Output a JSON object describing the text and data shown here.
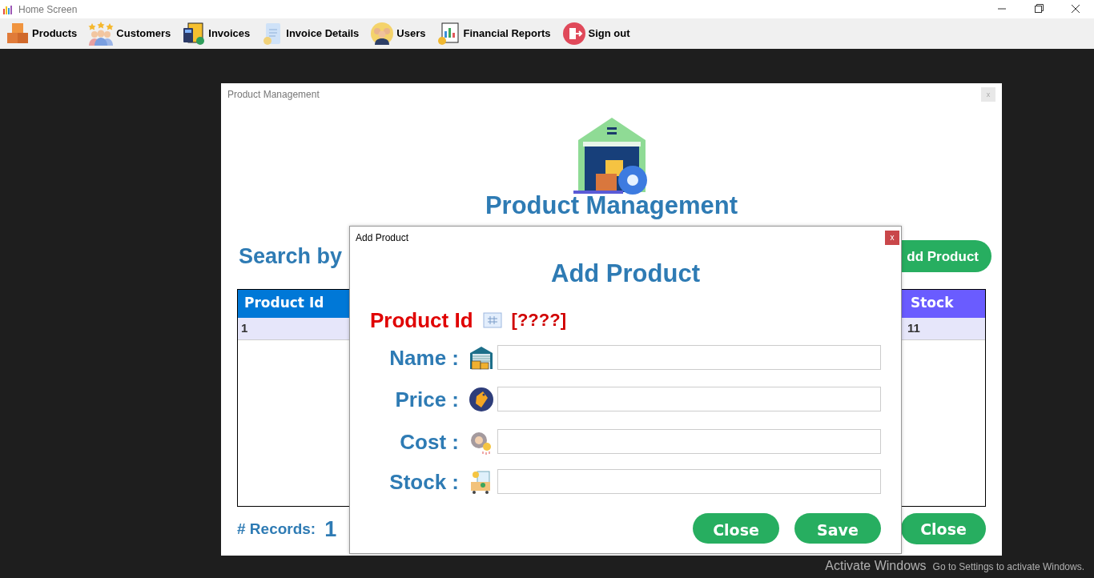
{
  "window": {
    "title": "Home Screen"
  },
  "menu": [
    {
      "label": "Products"
    },
    {
      "label": "Customers"
    },
    {
      "label": "Invoices"
    },
    {
      "label": "Invoice Details"
    },
    {
      "label": "Users"
    },
    {
      "label": "Financial Reports"
    },
    {
      "label": "Sign out"
    }
  ],
  "product_window": {
    "title": "Product Management",
    "close": "x",
    "heading": "Product Management",
    "search_label": "Search by",
    "add_button": "dd Product",
    "table": {
      "columns": [
        "Product Id",
        "Stock"
      ],
      "rows": [
        [
          "1",
          "11"
        ]
      ]
    },
    "records_label": "# Records:",
    "records_count": "1",
    "close_button": "Close"
  },
  "dialog": {
    "title": "Add Product",
    "close": "x",
    "heading": "Add Product",
    "id_label": "Product Id",
    "id_value": "[????]",
    "fields": [
      {
        "label": "Name :"
      },
      {
        "label": "Price :"
      },
      {
        "label": "Cost :"
      },
      {
        "label": "Stock :"
      }
    ],
    "buttons": [
      "Close",
      "Save"
    ]
  },
  "os_notice": {
    "title": "Activate Windows",
    "text": "Go to Settings to activate Windows."
  }
}
